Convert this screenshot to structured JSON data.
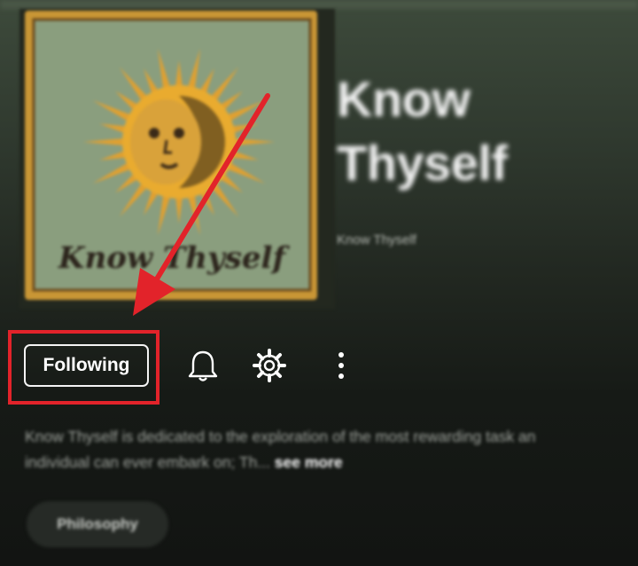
{
  "podcast": {
    "title": "Know Thyself",
    "author": "Know Thyself",
    "cover_text": "Know Thyself",
    "description": "Know Thyself is dedicated to the exploration of the most rewarding task an individual can ever embark on; Th...",
    "see_more_label": "see more"
  },
  "actions": {
    "follow_label": "Following",
    "bell_icon": "bell-icon",
    "settings_icon": "gear-icon",
    "more_icon": "more-vertical-icon"
  },
  "tags": [
    "Philosophy"
  ],
  "annotation": {
    "highlight_color": "#e2232a"
  },
  "colors": {
    "background_top": "#3d4a3b",
    "background_bottom": "#121412",
    "cover_bg": "#8a9e7e",
    "sun": "#e0a030"
  }
}
